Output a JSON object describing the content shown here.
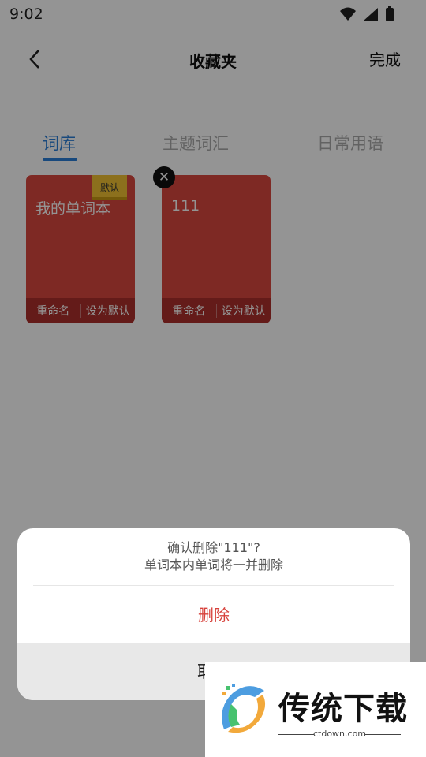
{
  "status": {
    "time": "9:02",
    "wifi_icon": "wifi-icon",
    "signal_icon": "signal-icon",
    "battery_icon": "battery-icon"
  },
  "header": {
    "back_icon": "chevron-left-icon",
    "title": "收藏夹",
    "done_label": "完成"
  },
  "tabs": [
    {
      "label": "词库",
      "active": true
    },
    {
      "label": "主题词汇",
      "active": false
    },
    {
      "label": "日常用语",
      "active": false
    }
  ],
  "cards": [
    {
      "title": "我的单词本",
      "badge": "默认",
      "rename_label": "重命名",
      "set_default_label": "设为默认"
    },
    {
      "title": "111",
      "rename_label": "重命名",
      "set_default_label": "设为默认"
    }
  ],
  "dialog": {
    "line1": "确认删除\"111\"?",
    "line2": "单词本内单词将一并删除",
    "delete_label": "删除",
    "cancel_label": "取消"
  },
  "watermark": {
    "brand_name": "传统下载",
    "url": "ctdown.com"
  },
  "colors": {
    "accent": "#2a7fd8",
    "card": "#d9473f",
    "danger": "#d7423c",
    "badge": "#f1c232"
  }
}
